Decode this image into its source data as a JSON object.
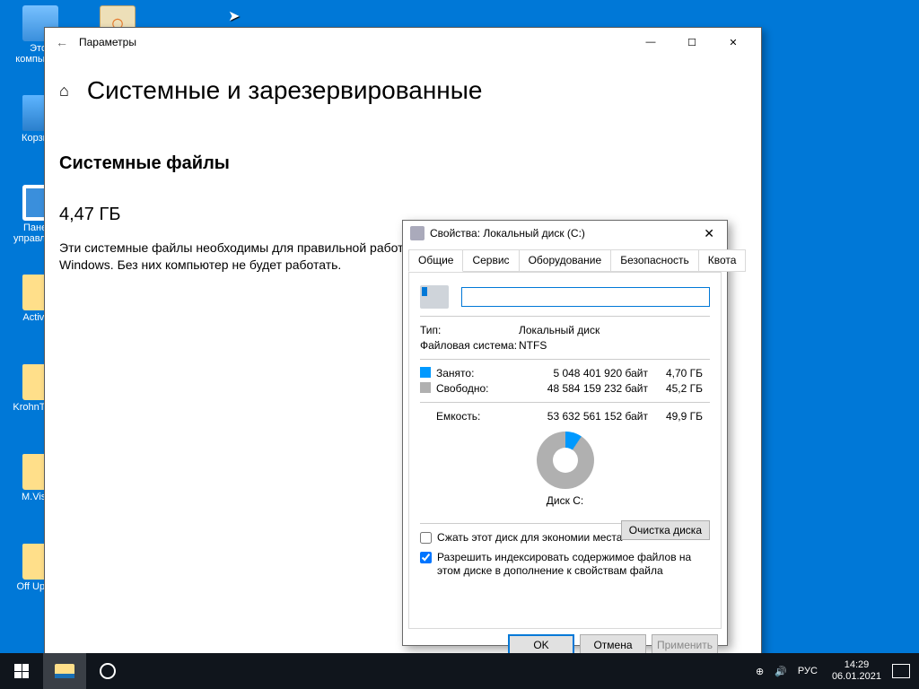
{
  "desktop": {
    "icons": [
      {
        "label": "Этот компьютер"
      },
      {
        "label": ""
      },
      {
        "label": "Корзина"
      },
      {
        "label": "Панель управления"
      },
      {
        "label": "Activate"
      },
      {
        "label": "KrohnTweak"
      },
      {
        "label": "M.Visual"
      },
      {
        "label": "Off Update"
      }
    ]
  },
  "settings": {
    "window_title": "Параметры",
    "page_title": "Системные и зарезервированные",
    "section_title": "Системные файлы",
    "size": "4,47 ГБ",
    "description": "Эти системные файлы необходимы для правильной работы Windows. Без них компьютер не будет работать."
  },
  "props": {
    "title": "Свойства: Локальный диск (C:)",
    "tabs": [
      "Общие",
      "Сервис",
      "Оборудование",
      "Безопасность",
      "Квота"
    ],
    "name_value": "",
    "type_label": "Тип:",
    "type_value": "Локальный диск",
    "fs_label": "Файловая система:",
    "fs_value": "NTFS",
    "used_label": "Занято:",
    "used_bytes": "5 048 401 920 байт",
    "used_human": "4,70 ГБ",
    "free_label": "Свободно:",
    "free_bytes": "48 584 159 232 байт",
    "free_human": "45,2 ГБ",
    "capacity_label": "Емкость:",
    "capacity_bytes": "53 632 561 152 байт",
    "capacity_human": "49,9 ГБ",
    "disk_label": "Диск C:",
    "cleanup_button": "Очистка диска",
    "compress_label": "Сжать этот диск для экономии места",
    "index_label": "Разрешить индексировать содержимое файлов на этом диске в дополнение к свойствам файла",
    "ok": "OK",
    "cancel": "Отмена",
    "apply": "Применить"
  },
  "taskbar": {
    "lang": "РУС",
    "time": "14:29",
    "date": "06.01.2021"
  },
  "chart_data": {
    "type": "pie",
    "title": "Диск C:",
    "series": [
      {
        "name": "Занято",
        "value": 5048401920,
        "human": "4,70 ГБ",
        "color": "#0099ff"
      },
      {
        "name": "Свободно",
        "value": 48584159232,
        "human": "45,2 ГБ",
        "color": "#b0b0b0"
      }
    ],
    "total": {
      "value": 53632561152,
      "human": "49,9 ГБ"
    }
  }
}
